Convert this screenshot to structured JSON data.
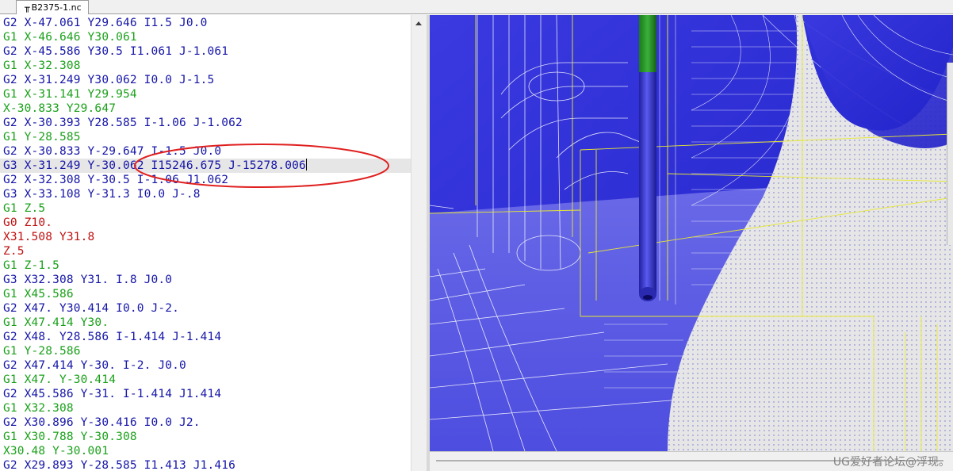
{
  "tab": {
    "title": "B2375-1.nc",
    "icon": "nc-file-icon"
  },
  "colors": {
    "g2": "#1515a8",
    "g1": "#1aa01a",
    "g0": "#c01010",
    "current_line_bg": "#e6e6e6",
    "annotation": "#e02020"
  },
  "editor": {
    "current_line_index": 10,
    "lines": [
      {
        "text": "G2 X-47.061 Y29.646 I1.5 J0.0",
        "color": "g2"
      },
      {
        "text": "G1 X-46.646 Y30.061",
        "color": "g1"
      },
      {
        "text": "G2 X-45.586 Y30.5 I1.061 J-1.061",
        "color": "g2"
      },
      {
        "text": "G1 X-32.308",
        "color": "g1"
      },
      {
        "text": "G2 X-31.249 Y30.062 I0.0 J-1.5",
        "color": "g2"
      },
      {
        "text": "G1 X-31.141 Y29.954",
        "color": "g1"
      },
      {
        "text": "X-30.833 Y29.647",
        "color": "g1"
      },
      {
        "text": "G2 X-30.393 Y28.585 I-1.06 J-1.062",
        "color": "g2"
      },
      {
        "text": "G1 Y-28.585",
        "color": "g1"
      },
      {
        "text": "G2 X-30.833 Y-29.647 I-1.5 J0.0",
        "color": "g2"
      },
      {
        "text": "G3 X-31.249 Y-30.062 I15246.675 J-15278.006",
        "color": "g2"
      },
      {
        "text": "G2 X-32.308 Y-30.5 I-1.06 J1.062",
        "color": "g2"
      },
      {
        "text": "G3 X-33.108 Y-31.3 I0.0 J-.8",
        "color": "g2"
      },
      {
        "text": "G1 Z.5",
        "color": "g1"
      },
      {
        "text": "G0 Z10.",
        "color": "g0"
      },
      {
        "text": "X31.508 Y31.8",
        "color": "g0"
      },
      {
        "text": "Z.5",
        "color": "g0"
      },
      {
        "text": "G1 Z-1.5",
        "color": "g1"
      },
      {
        "text": "G3 X32.308 Y31. I.8 J0.0",
        "color": "g2"
      },
      {
        "text": "G1 X45.586",
        "color": "g1"
      },
      {
        "text": "G2 X47. Y30.414 I0.0 J-2.",
        "color": "g2"
      },
      {
        "text": "G1 X47.414 Y30.",
        "color": "g1"
      },
      {
        "text": "G2 X48. Y28.586 I-1.414 J-1.414",
        "color": "g2"
      },
      {
        "text": "G1 Y-28.586",
        "color": "g1"
      },
      {
        "text": "G2 X47.414 Y-30. I-2. J0.0",
        "color": "g2"
      },
      {
        "text": "G1 X47. Y-30.414",
        "color": "g1"
      },
      {
        "text": "G2 X45.586 Y-31. I-1.414 J1.414",
        "color": "g2"
      },
      {
        "text": "G1 X32.308",
        "color": "g1"
      },
      {
        "text": "G2 X30.896 Y-30.416 I0.0 J2.",
        "color": "g2"
      },
      {
        "text": "G1 X30.788 Y-30.308",
        "color": "g1"
      },
      {
        "text": "X30.48 Y-30.001",
        "color": "g1"
      },
      {
        "text": "G2 X29.893 Y-28.585 I1.413 J1.416",
        "color": "g2"
      }
    ]
  },
  "watermark": "UG爱好者论坛@浮现。"
}
